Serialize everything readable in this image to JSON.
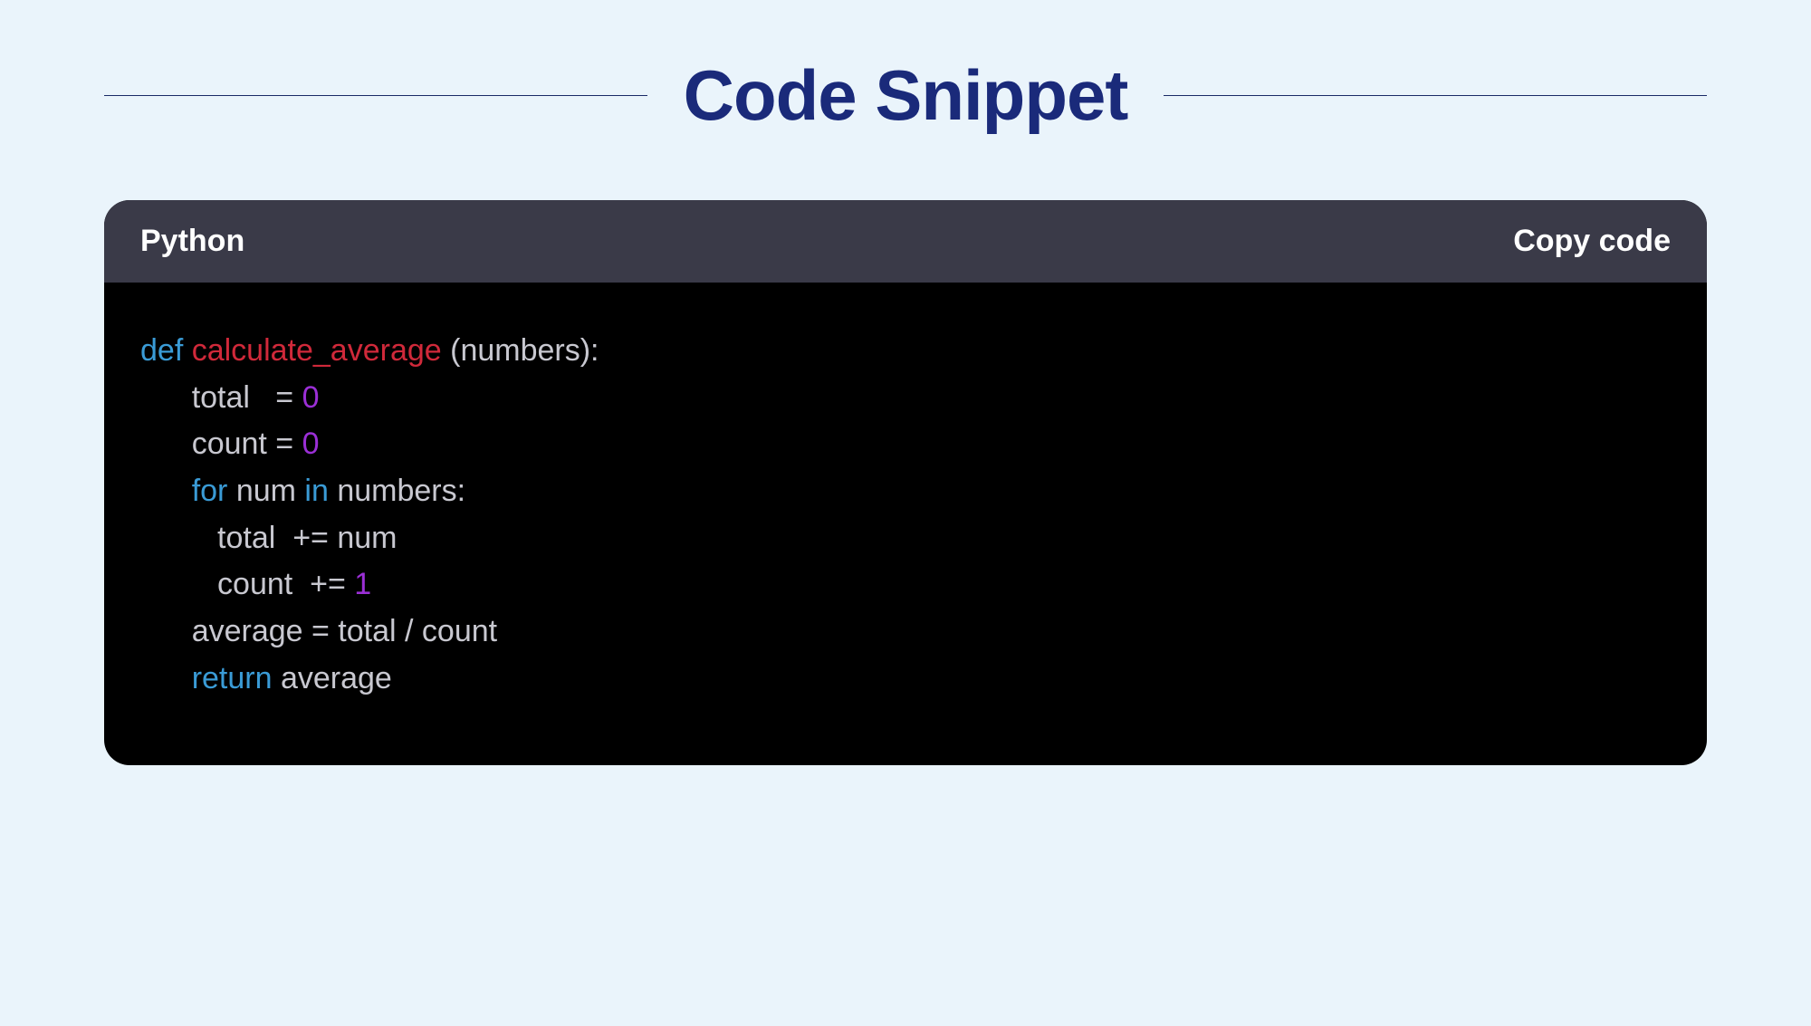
{
  "header": {
    "title": "Code Snippet"
  },
  "code_card": {
    "language": "Python",
    "copy_label": "Copy code",
    "tokens": {
      "line1_def": "def",
      "line1_funcname": " calculate_average",
      "line1_rest": " (numbers):",
      "line2_indent": "      ",
      "line2_text": "total   = ",
      "line2_num": "0",
      "line3_indent": "      ",
      "line3_text": "count = ",
      "line3_num": "0",
      "line4_indent": "      ",
      "line4_for": "for",
      "line4_mid": " num ",
      "line4_in": "in",
      "line4_rest": " numbers:",
      "line5_indent": "         ",
      "line5_text": "total  += num",
      "line6_indent": "         ",
      "line6_text": "count  += ",
      "line6_num": "1",
      "line7_indent": "      ",
      "line7_text": "average = total / count",
      "line8_indent": "      ",
      "line8_return": "return",
      "line8_rest": " average"
    }
  },
  "colors": {
    "background": "#eaf4fb",
    "title_color": "#1a2a7a",
    "rule_color": "#1a2a66",
    "code_header_bg": "#3a3a48",
    "code_body_bg": "#000000",
    "code_default": "#c8c8d0",
    "code_keyword": "#3a9bd6",
    "code_funcname": "#d0293a",
    "code_number": "#9b2fd6"
  }
}
